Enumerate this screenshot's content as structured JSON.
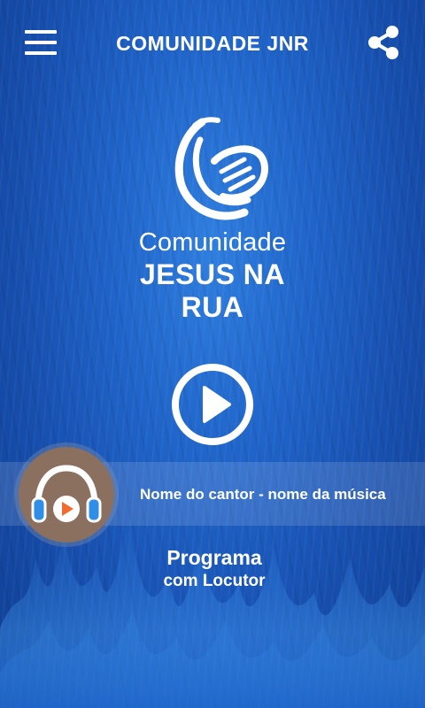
{
  "header": {
    "title": "COMUNIDADE JNR",
    "menu_icon": "hamburger-menu-icon",
    "share_icon": "share-icon"
  },
  "logo": {
    "line1": "Comunidade",
    "line2": "JESUS NA RUA",
    "mark_icon": "microphone-logo-icon"
  },
  "player": {
    "play_icon": "play-icon",
    "now_playing": "Nome do cantor - nome da música",
    "avatar_icon": "headphones-play-icon"
  },
  "program": {
    "name": "Programa",
    "host": "com Locutor"
  },
  "colors": {
    "background": "#1f63c8",
    "text": "#ffffff",
    "avatar": "#8b6f5f",
    "headphones_blue": "#2f8fe8",
    "play_orange": "#f26a2e"
  }
}
